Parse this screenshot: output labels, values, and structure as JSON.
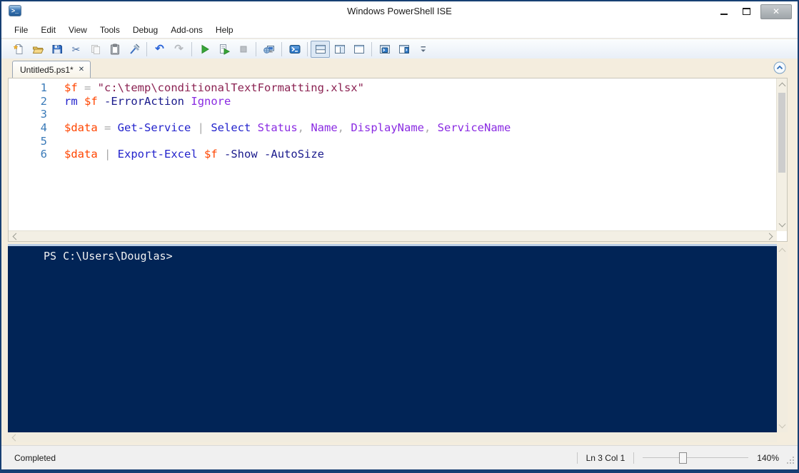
{
  "window": {
    "title": "Windows PowerShell ISE",
    "app_icon": ">_",
    "close_glyph": "✕"
  },
  "menu": {
    "items": [
      "File",
      "Edit",
      "View",
      "Tools",
      "Debug",
      "Add-ons",
      "Help"
    ]
  },
  "toolbar": {
    "buttons": [
      {
        "icon": "new-script"
      },
      {
        "icon": "open"
      },
      {
        "icon": "save"
      },
      {
        "icon": "cut"
      },
      {
        "icon": "copy",
        "disabled": true
      },
      {
        "icon": "paste"
      },
      {
        "icon": "clear-pane"
      },
      {
        "sep": true
      },
      {
        "icon": "undo"
      },
      {
        "icon": "redo",
        "disabled": true
      },
      {
        "sep": true
      },
      {
        "icon": "run"
      },
      {
        "icon": "run-selection"
      },
      {
        "icon": "stop",
        "disabled": true
      },
      {
        "sep": true
      },
      {
        "icon": "remote-tab"
      },
      {
        "sep": true
      },
      {
        "icon": "powershell"
      },
      {
        "sep": true
      },
      {
        "icon": "pane-top",
        "selected": true
      },
      {
        "icon": "pane-right"
      },
      {
        "icon": "pane-max"
      },
      {
        "sep": true
      },
      {
        "icon": "command-window"
      },
      {
        "icon": "command-addon"
      },
      {
        "icon": "overflow"
      }
    ]
  },
  "tabstrip": {
    "tabs": [
      {
        "label": "Untitled5.ps1*",
        "close_glyph": "✕",
        "active": true
      }
    ]
  },
  "editor": {
    "lines": [
      {
        "num": "1",
        "tokens": [
          [
            "$f",
            "var"
          ],
          [
            " = ",
            "op"
          ],
          [
            "\"c:\\temp\\conditionalTextFormatting.xlsx\"",
            "str"
          ]
        ]
      },
      {
        "num": "2",
        "tokens": [
          [
            "rm",
            "cmd"
          ],
          [
            " ",
            "pl"
          ],
          [
            "$f",
            "var"
          ],
          [
            " ",
            "pl"
          ],
          [
            "-ErrorAction",
            "param"
          ],
          [
            " ",
            "pl"
          ],
          [
            "Ignore",
            "member"
          ]
        ]
      },
      {
        "num": "3",
        "tokens": []
      },
      {
        "num": "4",
        "tokens": [
          [
            "$data",
            "var"
          ],
          [
            " = ",
            "op"
          ],
          [
            "Get-Service",
            "cmd"
          ],
          [
            " | ",
            "op"
          ],
          [
            "Select",
            "cmd"
          ],
          [
            " ",
            "pl"
          ],
          [
            "Status",
            "member"
          ],
          [
            ", ",
            "op"
          ],
          [
            "Name",
            "member"
          ],
          [
            ", ",
            "op"
          ],
          [
            "DisplayName",
            "member"
          ],
          [
            ", ",
            "op"
          ],
          [
            "ServiceName",
            "member"
          ]
        ]
      },
      {
        "num": "5",
        "tokens": []
      },
      {
        "num": "6",
        "tokens": [
          [
            "$data",
            "var"
          ],
          [
            " | ",
            "op"
          ],
          [
            "Export-Excel",
            "cmd"
          ],
          [
            " ",
            "pl"
          ],
          [
            "$f",
            "var"
          ],
          [
            " ",
            "pl"
          ],
          [
            "-Show",
            "param"
          ],
          [
            " ",
            "pl"
          ],
          [
            "-AutoSize",
            "param"
          ]
        ]
      }
    ]
  },
  "console": {
    "prompt": "PS C:\\Users\\Douglas>"
  },
  "statusbar": {
    "state": "Completed",
    "line_col": "Ln 3 Col 1",
    "zoom_value": "140%"
  },
  "colors": {
    "window_border": "#173f73",
    "console_bg": "#012456",
    "token_var": "#ff4500",
    "token_cmd": "#2323cc",
    "token_param": "#1a1a8c",
    "token_member": "#8a2be2",
    "token_string": "#8b2252",
    "token_operator": "#a9a9a9",
    "line_number": "#3a7ab8"
  }
}
